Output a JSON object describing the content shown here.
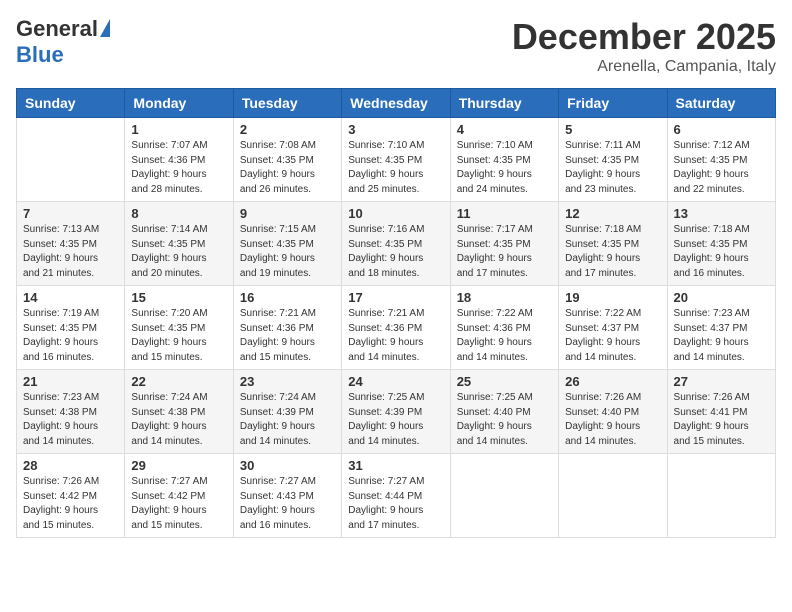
{
  "logo": {
    "general": "General",
    "blue": "Blue"
  },
  "header": {
    "month": "December 2025",
    "location": "Arenella, Campania, Italy"
  },
  "weekdays": [
    "Sunday",
    "Monday",
    "Tuesday",
    "Wednesday",
    "Thursday",
    "Friday",
    "Saturday"
  ],
  "weeks": [
    [
      {
        "day": "",
        "info": ""
      },
      {
        "day": "1",
        "info": "Sunrise: 7:07 AM\nSunset: 4:36 PM\nDaylight: 9 hours\nand 28 minutes."
      },
      {
        "day": "2",
        "info": "Sunrise: 7:08 AM\nSunset: 4:35 PM\nDaylight: 9 hours\nand 26 minutes."
      },
      {
        "day": "3",
        "info": "Sunrise: 7:10 AM\nSunset: 4:35 PM\nDaylight: 9 hours\nand 25 minutes."
      },
      {
        "day": "4",
        "info": "Sunrise: 7:10 AM\nSunset: 4:35 PM\nDaylight: 9 hours\nand 24 minutes."
      },
      {
        "day": "5",
        "info": "Sunrise: 7:11 AM\nSunset: 4:35 PM\nDaylight: 9 hours\nand 23 minutes."
      },
      {
        "day": "6",
        "info": "Sunrise: 7:12 AM\nSunset: 4:35 PM\nDaylight: 9 hours\nand 22 minutes."
      }
    ],
    [
      {
        "day": "7",
        "info": "Sunrise: 7:13 AM\nSunset: 4:35 PM\nDaylight: 9 hours\nand 21 minutes."
      },
      {
        "day": "8",
        "info": "Sunrise: 7:14 AM\nSunset: 4:35 PM\nDaylight: 9 hours\nand 20 minutes."
      },
      {
        "day": "9",
        "info": "Sunrise: 7:15 AM\nSunset: 4:35 PM\nDaylight: 9 hours\nand 19 minutes."
      },
      {
        "day": "10",
        "info": "Sunrise: 7:16 AM\nSunset: 4:35 PM\nDaylight: 9 hours\nand 18 minutes."
      },
      {
        "day": "11",
        "info": "Sunrise: 7:17 AM\nSunset: 4:35 PM\nDaylight: 9 hours\nand 17 minutes."
      },
      {
        "day": "12",
        "info": "Sunrise: 7:18 AM\nSunset: 4:35 PM\nDaylight: 9 hours\nand 17 minutes."
      },
      {
        "day": "13",
        "info": "Sunrise: 7:18 AM\nSunset: 4:35 PM\nDaylight: 9 hours\nand 16 minutes."
      }
    ],
    [
      {
        "day": "14",
        "info": "Sunrise: 7:19 AM\nSunset: 4:35 PM\nDaylight: 9 hours\nand 16 minutes."
      },
      {
        "day": "15",
        "info": "Sunrise: 7:20 AM\nSunset: 4:35 PM\nDaylight: 9 hours\nand 15 minutes."
      },
      {
        "day": "16",
        "info": "Sunrise: 7:21 AM\nSunset: 4:36 PM\nDaylight: 9 hours\nand 15 minutes."
      },
      {
        "day": "17",
        "info": "Sunrise: 7:21 AM\nSunset: 4:36 PM\nDaylight: 9 hours\nand 14 minutes."
      },
      {
        "day": "18",
        "info": "Sunrise: 7:22 AM\nSunset: 4:36 PM\nDaylight: 9 hours\nand 14 minutes."
      },
      {
        "day": "19",
        "info": "Sunrise: 7:22 AM\nSunset: 4:37 PM\nDaylight: 9 hours\nand 14 minutes."
      },
      {
        "day": "20",
        "info": "Sunrise: 7:23 AM\nSunset: 4:37 PM\nDaylight: 9 hours\nand 14 minutes."
      }
    ],
    [
      {
        "day": "21",
        "info": "Sunrise: 7:23 AM\nSunset: 4:38 PM\nDaylight: 9 hours\nand 14 minutes."
      },
      {
        "day": "22",
        "info": "Sunrise: 7:24 AM\nSunset: 4:38 PM\nDaylight: 9 hours\nand 14 minutes."
      },
      {
        "day": "23",
        "info": "Sunrise: 7:24 AM\nSunset: 4:39 PM\nDaylight: 9 hours\nand 14 minutes."
      },
      {
        "day": "24",
        "info": "Sunrise: 7:25 AM\nSunset: 4:39 PM\nDaylight: 9 hours\nand 14 minutes."
      },
      {
        "day": "25",
        "info": "Sunrise: 7:25 AM\nSunset: 4:40 PM\nDaylight: 9 hours\nand 14 minutes."
      },
      {
        "day": "26",
        "info": "Sunrise: 7:26 AM\nSunset: 4:40 PM\nDaylight: 9 hours\nand 14 minutes."
      },
      {
        "day": "27",
        "info": "Sunrise: 7:26 AM\nSunset: 4:41 PM\nDaylight: 9 hours\nand 15 minutes."
      }
    ],
    [
      {
        "day": "28",
        "info": "Sunrise: 7:26 AM\nSunset: 4:42 PM\nDaylight: 9 hours\nand 15 minutes."
      },
      {
        "day": "29",
        "info": "Sunrise: 7:27 AM\nSunset: 4:42 PM\nDaylight: 9 hours\nand 15 minutes."
      },
      {
        "day": "30",
        "info": "Sunrise: 7:27 AM\nSunset: 4:43 PM\nDaylight: 9 hours\nand 16 minutes."
      },
      {
        "day": "31",
        "info": "Sunrise: 7:27 AM\nSunset: 4:44 PM\nDaylight: 9 hours\nand 17 minutes."
      },
      {
        "day": "",
        "info": ""
      },
      {
        "day": "",
        "info": ""
      },
      {
        "day": "",
        "info": ""
      }
    ]
  ]
}
